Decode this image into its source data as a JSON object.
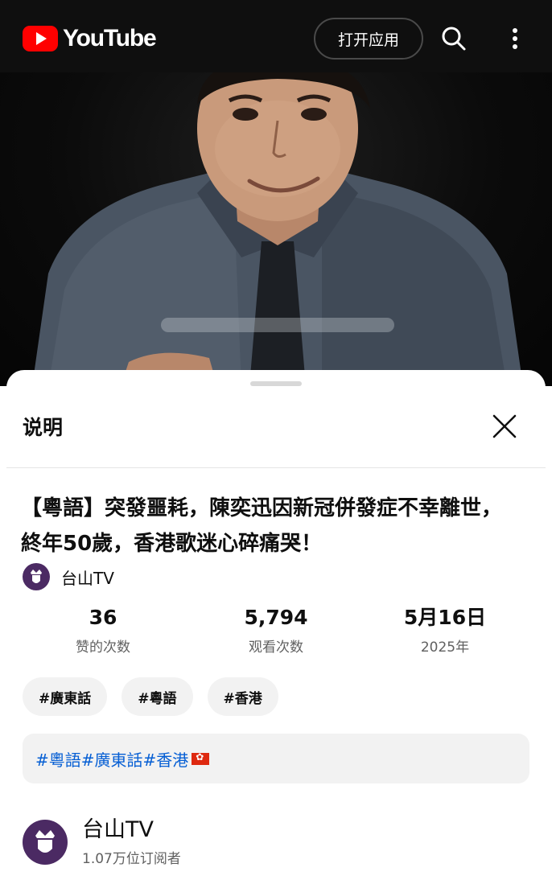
{
  "header": {
    "logo_text": "YouTube",
    "open_app_label": "打开应用",
    "icons": [
      "youtube-play-icon",
      "search-icon",
      "more-vertical-icon"
    ]
  },
  "sheet": {
    "title": "说明",
    "close_icon": "close-icon"
  },
  "video": {
    "title": "【粵語】突發噩耗，陳奕迅因新冠併發症不幸離世，終年50歲，香港歌迷心碎痛哭！",
    "channel_name": "台山TV"
  },
  "stats": [
    {
      "value": "36",
      "label": "赞的次数"
    },
    {
      "value": "5,794",
      "label": "观看次数"
    },
    {
      "value": "5月16日",
      "label": "2025年"
    }
  ],
  "tags": [
    "#廣東話",
    "#粵語",
    "#香港"
  ],
  "description": {
    "text": "#粵語#廣東話#香港",
    "flag_icon": "hong-kong-flag-icon"
  },
  "channel": {
    "name": "台山TV",
    "subscribers": "1.07万位订阅者"
  },
  "colors": {
    "brand_red": "#ff0000",
    "link_blue": "#065fd4",
    "avatar_purple": "#4b2a63"
  }
}
